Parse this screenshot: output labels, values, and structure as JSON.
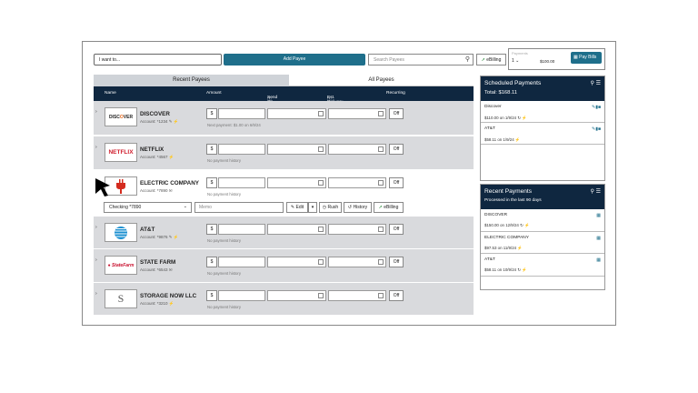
{
  "topbar": {
    "i_want_to": "I want to...",
    "add_payee": "Add Payee",
    "search_placeholder": "Search Payees",
    "ebilling": "eBilling",
    "payments_label": "Payments",
    "payments_count": "1",
    "payments_total": "$100.00",
    "pay_bills": "Pay Bills"
  },
  "tabs": {
    "recent": "Recent Payees",
    "all": "All Payees"
  },
  "columns": {
    "name": "Name",
    "amount": "Amount",
    "send_on": "Send On",
    "delivery": "Est. Delivery",
    "recurring": "Recurring"
  },
  "payees": [
    {
      "name": "DISCOVER",
      "account": "Account: *1234",
      "logo": "DISCOVER",
      "history": "Next payment: $1.00 on 6/9/24",
      "recurring": "Off"
    },
    {
      "name": "NETFLIX",
      "account": "Account: *4567",
      "logo": "NETFLIX",
      "history": "No payment history",
      "recurring": "Off"
    },
    {
      "name": "ELECTRIC COMPANY",
      "account": "Account: *7890",
      "logo": "plug",
      "history": "No payment history",
      "recurring": "Off"
    },
    {
      "name": "AT&T",
      "account": "Account: *9876",
      "logo": "AT&T",
      "history": "No payment history",
      "recurring": "Off"
    },
    {
      "name": "STATE FARM",
      "account": "Account: *6543",
      "logo": "StateFarm",
      "history": "No payment history",
      "recurring": "Off"
    },
    {
      "name": "STORAGE NOW LLC",
      "account": "Account: *3210",
      "logo": "S",
      "history": "No payment history",
      "recurring": "Off"
    }
  ],
  "expanded": {
    "account": "Checking *7890",
    "memo_placeholder": "Memo",
    "edit": "Edit",
    "rush": "Rush",
    "history": "History",
    "ebilling": "eBilling"
  },
  "scheduled": {
    "title": "Scheduled Payments",
    "total": "Total: $168.11",
    "items": [
      {
        "name": "Discover",
        "detail": "$110.00 on 1/9/24"
      },
      {
        "name": "AT&T",
        "detail": "$58.11 on 1/9/24"
      }
    ]
  },
  "recent": {
    "title": "Recent Payments",
    "subtitle": "Processed in the last 90 days",
    "items": [
      {
        "name": "DISCOVER",
        "detail": "$150.00 on 12/9/24"
      },
      {
        "name": "ELECTRIC COMPANY",
        "detail": "$97.53 on 11/9/24"
      },
      {
        "name": "AT&T",
        "detail": "$58.11 on 10/9/24"
      }
    ]
  },
  "colors": {
    "navy": "#0f2740",
    "teal": "#1f6f8b",
    "shade": "#d9dadd"
  }
}
